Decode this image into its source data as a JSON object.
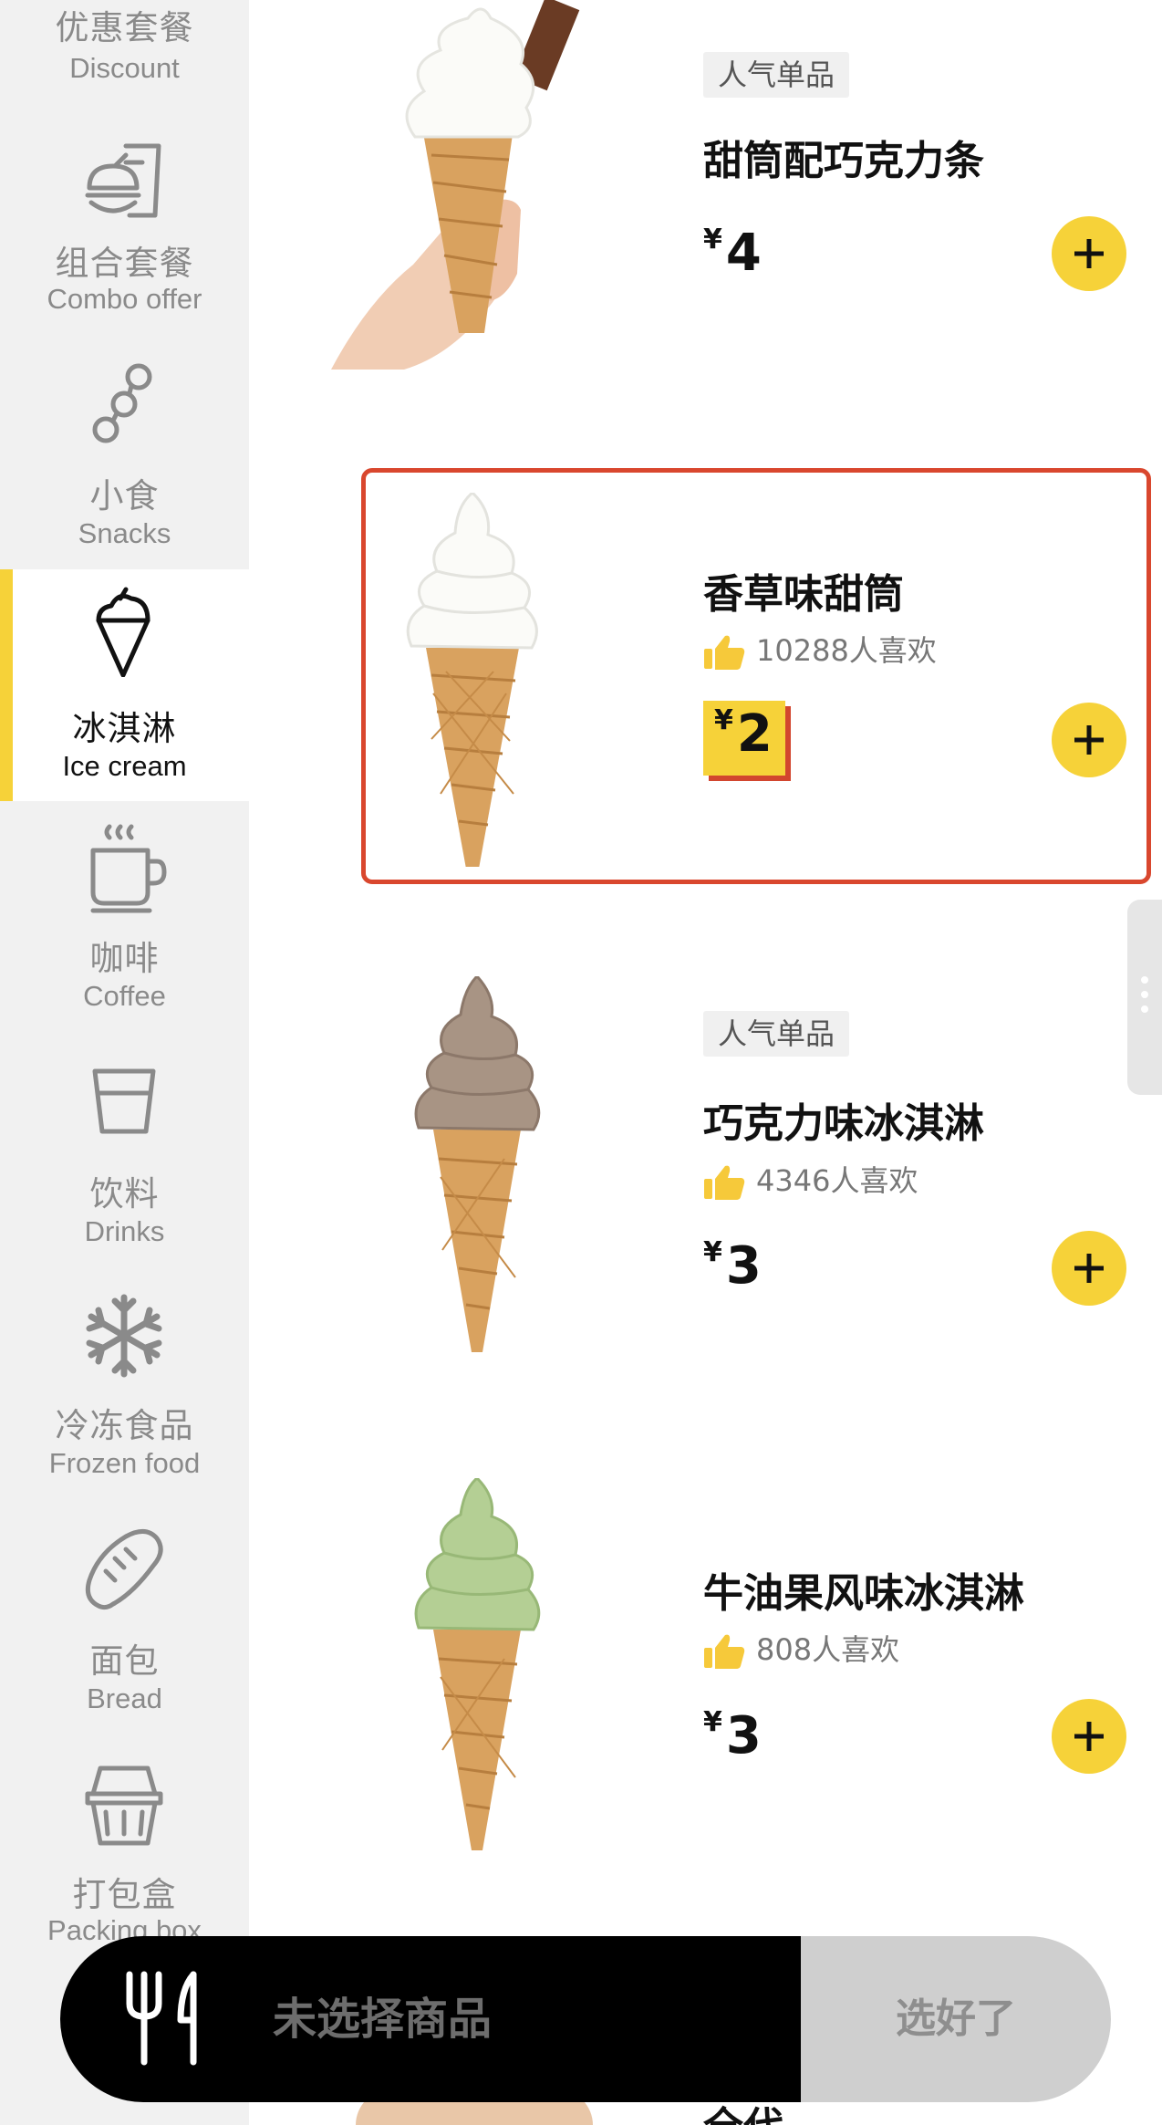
{
  "sidebar": {
    "categories": [
      {
        "zh": "优惠套餐",
        "en": "Discount",
        "icon": "discount-icon"
      },
      {
        "zh": "组合套餐",
        "en": "Combo offer",
        "icon": "combo-meal-icon"
      },
      {
        "zh": "小食",
        "en": "Snacks",
        "icon": "snack-skewer-icon"
      },
      {
        "zh": "冰淇淋",
        "en": "Ice cream",
        "icon": "ice-cream-icon",
        "active": true
      },
      {
        "zh": "咖啡",
        "en": "Coffee",
        "icon": "coffee-cup-icon"
      },
      {
        "zh": "饮料",
        "en": "Drinks",
        "icon": "drink-glass-icon"
      },
      {
        "zh": "冷冻食品",
        "en": "Frozen food",
        "icon": "snowflake-icon"
      },
      {
        "zh": "面包",
        "en": "Bread",
        "icon": "bread-icon"
      },
      {
        "zh": "打包盒",
        "en": "Packing box",
        "icon": "packing-box-icon"
      }
    ]
  },
  "products": [
    {
      "tag": "人气单品",
      "name": "甜筒配巧克力条",
      "currency": "¥",
      "price": "4"
    },
    {
      "name": "香草味甜筒",
      "likes": "10288人喜欢",
      "currency": "¥",
      "price": "2",
      "promo": true
    },
    {
      "tag": "人气单品",
      "name": "巧克力味冰淇淋",
      "likes": "4346人喜欢",
      "currency": "¥",
      "price": "3"
    },
    {
      "name": "牛油果风味冰淇淋",
      "likes": "808人喜欢",
      "currency": "¥",
      "price": "3"
    },
    {
      "name": "全代"
    }
  ],
  "cart": {
    "status": "未选择商品",
    "checkout_label": "选好了"
  },
  "colors": {
    "accent_yellow": "#f6d239",
    "highlight_red": "#d9472e",
    "sidebar_bg": "#f1f1f1"
  }
}
